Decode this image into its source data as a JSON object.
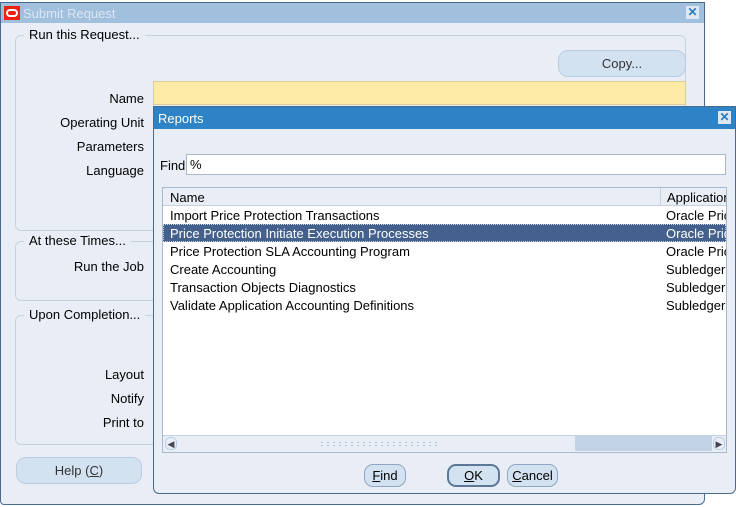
{
  "main_window": {
    "title": "Submit Request",
    "logo_icon": "oracle-logo-icon",
    "close_icon": "close-icon",
    "groups": {
      "run_request": {
        "legend": "Run this Request..."
      },
      "at_times": {
        "legend": "At these Times..."
      },
      "upon_completion": {
        "legend": "Upon Completion..."
      }
    },
    "copy_button": "Copy...",
    "fields": {
      "name": {
        "label": "Name",
        "value": ""
      },
      "operating_unit": {
        "label": "Operating Unit"
      },
      "parameters": {
        "label": "Parameters"
      },
      "language": {
        "label": "Language"
      },
      "run_the_job": {
        "label": "Run the Job"
      },
      "layout": {
        "label": "Layout"
      },
      "notify": {
        "label": "Notify"
      },
      "print_to": {
        "label": "Print to"
      }
    },
    "help_button": {
      "prefix": "Help (",
      "mnemonic": "C",
      "suffix": ")"
    }
  },
  "reports_dialog": {
    "title": "Reports",
    "close_icon": "close-icon",
    "find_label": "Find",
    "find_value": "%",
    "columns": [
      "Name",
      "Application"
    ],
    "rows": [
      {
        "name": "Import Price Protection Transactions",
        "application": "Oracle Pric",
        "selected": false
      },
      {
        "name": "Price Protection Initiate Execution Processes",
        "application": "Oracle Pric",
        "selected": true
      },
      {
        "name": "Price Protection SLA Accounting Program",
        "application": "Oracle Pric",
        "selected": false
      },
      {
        "name": "Create Accounting",
        "application": "Subledger",
        "selected": false
      },
      {
        "name": "Transaction Objects Diagnostics",
        "application": "Subledger",
        "selected": false
      },
      {
        "name": "Validate Application Accounting Definitions",
        "application": "Subledger",
        "selected": false
      }
    ],
    "buttons": {
      "find": {
        "mnemonic": "F",
        "rest": "ind"
      },
      "ok": {
        "mnemonic": "O",
        "rest": "K"
      },
      "cancel": {
        "mnemonic": "C",
        "rest": "ancel"
      }
    }
  },
  "colors": {
    "title_bar_inactive": "#a1c0de",
    "title_bar_active": "#2d83c6",
    "selected_row": "#43618c",
    "required_field": "#ffeba8",
    "window_bg": "#e9eef6"
  }
}
